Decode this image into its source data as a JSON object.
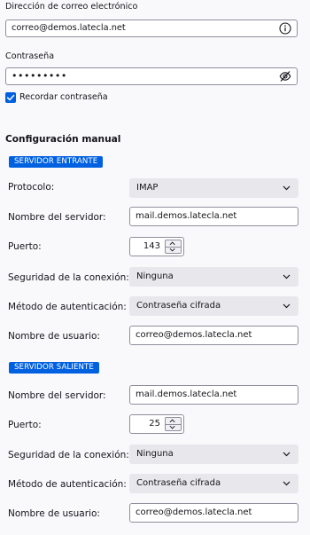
{
  "account": {
    "email_label": "Dirección de correo electrónico",
    "email_value": "correo@demos.latecla.net",
    "password_label": "Contraseña",
    "password_mask": "•••••••••",
    "remember_label": "Recordar contraseña",
    "remember_checked": true
  },
  "manual": {
    "title": "Configuración manual",
    "incoming": {
      "badge": "SERVIDOR ENTRANTE",
      "protocol_label": "Protocolo:",
      "protocol_value": "IMAP",
      "server_label": "Nombre del servidor:",
      "server_value": "mail.demos.latecla.net",
      "port_label": "Puerto:",
      "port_value": "143",
      "security_label": "Seguridad de la conexión:",
      "security_value": "Ninguna",
      "auth_label": "Método de autenticación:",
      "auth_value": "Contraseña cifrada",
      "username_label": "Nombre de usuario:",
      "username_value": "correo@demos.latecla.net"
    },
    "outgoing": {
      "badge": "SERVIDOR SALIENTE",
      "server_label": "Nombre del servidor:",
      "server_value": "mail.demos.latecla.net",
      "port_label": "Puerto:",
      "port_value": "25",
      "security_label": "Seguridad de la conexión:",
      "security_value": "Ninguna",
      "auth_label": "Método de autenticación:",
      "auth_value": "Contraseña cifrada",
      "username_label": "Nombre de usuario:",
      "username_value": "correo@demos.latecla.net"
    }
  },
  "colors": {
    "accent": "#0061e0",
    "background": "#f9f9fb",
    "select_bg": "#e8e8ec",
    "border": "#8f8f9d"
  },
  "icons": {
    "info": "info-circle-icon",
    "password_toggle": "eye-slash-icon",
    "checkmark": "checkmark-icon",
    "dropdown": "chevron-down-icon",
    "spinner_up": "chevron-up-icon",
    "spinner_down": "chevron-down-icon"
  }
}
